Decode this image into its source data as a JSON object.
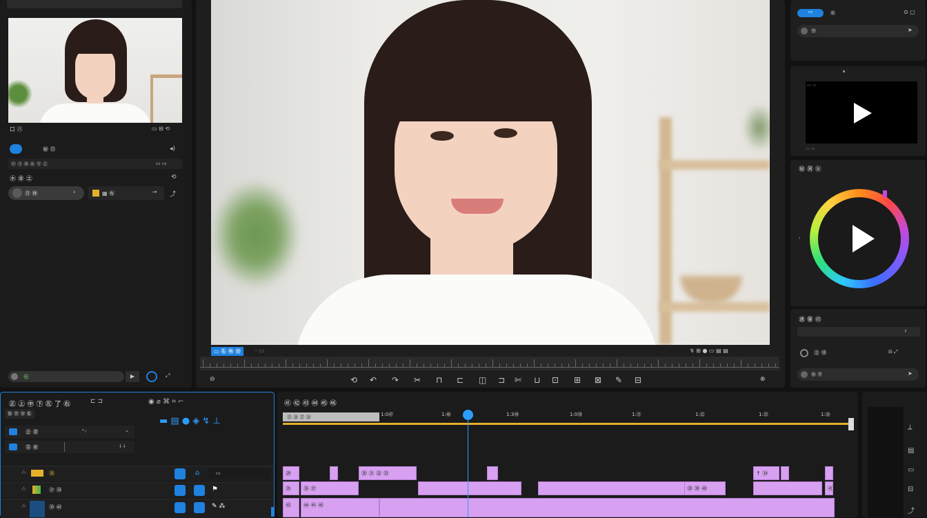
{
  "left_panel": {
    "preview_caption_left": "口 ㊇",
    "preview_caption_right": "▭ ⊟ ⟲",
    "row1_label": "㊙ ㊐",
    "row2_text": "㊞ ㊟ ㊠ ㊡ ㊢ ㊣",
    "row2_right": "▭ ▭",
    "section_title": "㊍ ㊎ ㊏",
    "chip1_label": "㊐ ㊑",
    "chip2_label": "▦ ㊒",
    "bottom_value": "㊓"
  },
  "viewer": {
    "tab_active": "▭ ㊔ ㊕ ㊖",
    "tab_sep": "- ▭",
    "timecode_icons": "↯ ⊞ ● ▭ ▤ ▤"
  },
  "toolbar": {
    "items": [
      "⟲",
      "↶",
      "↷",
      "✂",
      "⊓",
      "⊏",
      "◫",
      "⊐",
      "✄",
      "⊔",
      "⊡",
      "⊞",
      "⊠",
      "✎",
      "⊟"
    ],
    "left_label": "⊖",
    "right_label": "⊕"
  },
  "right_panel": {
    "top_pill": "▭",
    "top_text": "㊗",
    "top_pill2": "㊘",
    "section1_title": "㊙ ㊚ ㊛",
    "section2_title": "㊜ ㊝ ㊞",
    "setting_label": "㊟ ㊠",
    "bottom_button": "㊡ ㊢",
    "small_value": "⁄⁄"
  },
  "timeline_header": {
    "title": "㊣ ㊤ ㊥ ㊦ ㊧ 了 ㊨",
    "subtitle": "㊩ ㊪ ㊫ ㊬",
    "track1_label": "㊭ ㊮",
    "track2_label": "㊯ ㊰",
    "track1_value": "⁰ ⁄",
    "track2_value": "⸸ ⸸",
    "track_names": [
      "㊱",
      "㊲ ㊳",
      "㊴ ㊵"
    ],
    "edit_title": "㊶ ㊷ ㊸ ㊹ ㊺ ㊻",
    "ruler_labels": [
      "1:0㊼",
      "1:㊽",
      "1:3㊾",
      "1:0㊿",
      "1:㉑",
      "1:㉒",
      "1:㉓",
      "1:㉔"
    ],
    "work_area": "㉕ ㉖ ㉗ ㉘"
  },
  "clips": {
    "row1": [
      "㉙",
      "",
      "㉚ ㉛ ㉜ ㉝",
      "",
      "↑ ㉞",
      "",
      ""
    ],
    "row2": [
      "㉟",
      "㊱ ㊲",
      "",
      "",
      "㊳ ㊴ ㊵",
      "",
      "㊶ ㊷"
    ],
    "row3": [
      "㊸",
      "㊹ ㊺ ㊻",
      "",
      "",
      "",
      "",
      ""
    ]
  },
  "accent_color": "#1f82e0",
  "clip_color": "#d7a0f0",
  "playhead_color": "#2d9cff"
}
